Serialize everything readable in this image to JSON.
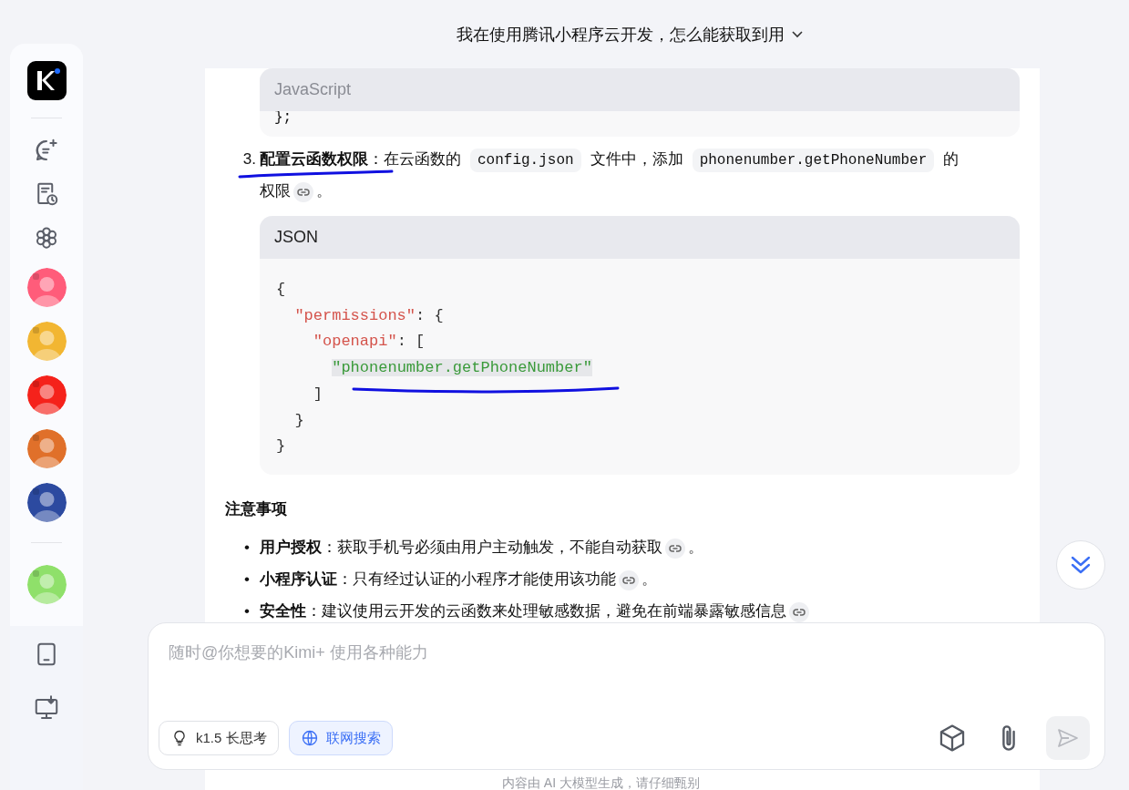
{
  "header": {
    "title": "我在使用腾讯小程序云开发，怎么能获取到用"
  },
  "sidebar": {
    "bots": [
      {
        "color": "#ff5c7a"
      },
      {
        "color": "#f2b632"
      },
      {
        "color": "#f5221b"
      },
      {
        "color": "#e0702a"
      },
      {
        "color": "#2c4aa0"
      }
    ],
    "pinned": [
      {
        "color": "#8fe06a"
      }
    ]
  },
  "message": {
    "partial_code": {
      "language": "JavaScript",
      "lines": [
        "};"
      ]
    },
    "step": {
      "number": "3.",
      "segments": [
        {
          "kind": "text",
          "text": "**配置云函数权限**：在云函数的"
        },
        {
          "kind": "code",
          "text": "config.json"
        },
        {
          "kind": "text",
          "text": "文件中，添加"
        },
        {
          "kind": "code",
          "text": "phonenumber.getPhoneNumber"
        },
        {
          "kind": "text",
          "text": "的权限"
        },
        {
          "kind": "cite"
        },
        {
          "kind": "text",
          "text": "。"
        }
      ]
    },
    "code": {
      "language": "JSON",
      "lines": [
        {
          "highlighted": false,
          "tokens": [
            {
              "kind": "punct",
              "text": "{"
            }
          ]
        },
        {
          "highlighted": false,
          "tokens": [
            {
              "kind": "key",
              "text": "  \"permissions\""
            },
            {
              "kind": "punct",
              "text": ": {"
            }
          ]
        },
        {
          "highlighted": false,
          "tokens": [
            {
              "kind": "key",
              "text": "    \"openapi\""
            },
            {
              "kind": "punct",
              "text": ": ["
            }
          ]
        },
        {
          "highlighted": true,
          "tokens": [
            {
              "kind": "string",
              "text": "      \"phonenumber.getPhoneNumber\""
            }
          ]
        },
        {
          "highlighted": false,
          "tokens": [
            {
              "kind": "punct",
              "text": "    ]"
            }
          ]
        },
        {
          "highlighted": false,
          "tokens": [
            {
              "kind": "punct",
              "text": "  }"
            }
          ]
        },
        {
          "highlighted": false,
          "tokens": [
            {
              "kind": "punct",
              "text": "}"
            }
          ]
        }
      ]
    },
    "heading": "注意事项",
    "bullets": [
      {
        "marker": "•",
        "text": "**用户授权**：获取手机号必须由用户主动触发，不能自动获取",
        "cite": true,
        "end": "。"
      },
      {
        "marker": "•",
        "text": "**小程序认证**：只有经过认证的小程序才能使用该功能",
        "cite": true,
        "end": "。"
      },
      {
        "marker": "•",
        "text": "**安全性**：建议使用云开发的云函数来处理敏感数据，避免在前端暴露敏感信息",
        "cite": true
      }
    ]
  },
  "input": {
    "placeholder": "随时@你想要的Kimi+ 使用各种能力",
    "chips": [
      {
        "label": "k1.5 长思考",
        "selected": false
      },
      {
        "label": "联网搜索",
        "selected": true
      }
    ],
    "send_disabled": true
  },
  "footer": "内容由 AI 大模型生成，请仔细甄别"
}
